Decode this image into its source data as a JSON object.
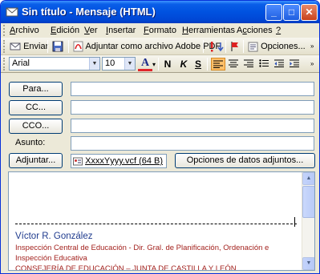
{
  "window": {
    "title": "Sin título - Mensaje (HTML)"
  },
  "window_controls": {
    "min": "_",
    "max": "□",
    "close": "✕"
  },
  "menu": {
    "archivo": {
      "u": "A",
      "rest": "rchivo"
    },
    "edicion": {
      "u": "E",
      "rest": "dición"
    },
    "ver": {
      "u": "V",
      "rest": "er"
    },
    "insertar": {
      "u": "I",
      "rest": "nsertar"
    },
    "formato": {
      "u": "F",
      "rest": "ormato"
    },
    "herramientas": {
      "u": "H",
      "rest": "erramientas"
    },
    "acciones": {
      "u": "c",
      "pre": "A",
      "rest": "ciones"
    },
    "help": "?"
  },
  "toolbar": {
    "send_label": "Enviar",
    "attach_pdf_label": "Adjuntar como archivo Adobe PDF",
    "options_label": "Opciones..."
  },
  "format": {
    "font": "Arial",
    "size": "10",
    "bold": "N",
    "italic": "K",
    "underline": "S",
    "font_color": "A"
  },
  "form": {
    "to_label": "Para...",
    "cc_label": "CC...",
    "bcc_label": "CCO...",
    "subject_label": "Asunto:",
    "attach_label": "Adjuntar...",
    "attachment_name": "XxxxYyyy.vcf (64 B)",
    "attach_options_label": "Opciones de datos adjuntos..."
  },
  "signature": {
    "name": "Víctor R. González",
    "lines": [
      "Inspección Central de Educación - Dir. Gral. de Planificación, Ordenación e",
      "Inspección Educativa",
      "CONSEJERÍA DE EDUCACIÓN – JUNTA DE CASTILLA Y LEÓN"
    ]
  }
}
